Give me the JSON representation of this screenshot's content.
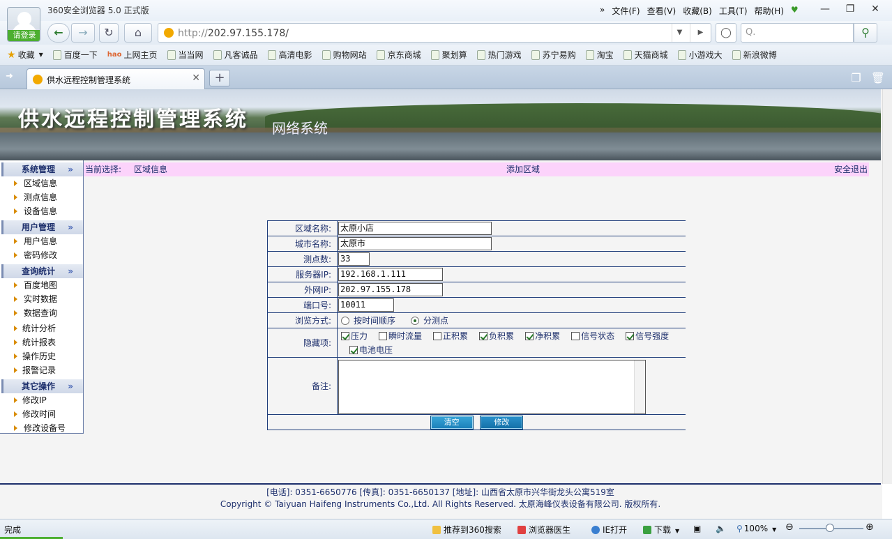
{
  "browser": {
    "app_title": "360安全浏览器 5.0 正式版",
    "login_label": "请登录",
    "menu": [
      "文件(F)",
      "查看(V)",
      "收藏(B)",
      "工具(T)",
      "帮助(H)"
    ],
    "menu_more": "»",
    "address_scheme": "http://",
    "address_host": "202.97.155.178/",
    "search_placeholder": "Q.",
    "bookmarks": [
      "收藏",
      "百度一下",
      "上网主页",
      "当当网",
      "凡客诚品",
      "高清电影",
      "购物网站",
      "京东商城",
      "聚划算",
      "热门游戏",
      "苏宁易购",
      "淘宝",
      "天猫商城",
      "小游戏大",
      "新浪微博"
    ],
    "tab_title": "供水远程控制管理系统",
    "new_tab": "+",
    "status_done": "完成",
    "status_items": {
      "recommend": "推荐到360搜索",
      "doctor": "浏览器医生",
      "ie_open": "IE打开",
      "download": "下载",
      "zoom": "100%"
    }
  },
  "banner": {
    "title": "供水远程控制管理系统",
    "subtitle": "网络系统"
  },
  "sidebar": {
    "sections": [
      {
        "title": "系统管理",
        "items": [
          "区域信息",
          "测点信息",
          "设备信息"
        ]
      },
      {
        "title": "用户管理",
        "items": [
          "用户信息",
          "密码修改"
        ]
      },
      {
        "title": "查询统计",
        "items": [
          "百度地图",
          "实时数据",
          "数据查询",
          "统计分析",
          "统计报表",
          "操作历史",
          "报警记录"
        ]
      },
      {
        "title": "其它操作",
        "items": [
          "修改IP",
          "修改时间",
          "修改设备号"
        ]
      }
    ]
  },
  "topline": {
    "current_label": "当前选择:",
    "current_value": "区域信息",
    "add_link": "添加区域",
    "logout": "安全退出"
  },
  "form": {
    "region_name_label": "区域名称:",
    "region_name": "太原小店",
    "city_label": "城市名称:",
    "city": "太原市",
    "points_label": "测点数:",
    "points": "33",
    "server_ip_label": "服务器IP:",
    "server_ip": "192.168.1.111",
    "public_ip_label": "外网IP:",
    "public_ip": "202.97.155.178",
    "port_label": "端口号:",
    "port": "10011",
    "browse_label": "浏览方式:",
    "browse_options": [
      {
        "label": "按时间顺序",
        "selected": false
      },
      {
        "label": "分测点",
        "selected": true
      }
    ],
    "hidden_label": "隐藏项:",
    "hidden_items": [
      {
        "label": "压力",
        "checked": true
      },
      {
        "label": "瞬时流量",
        "checked": false
      },
      {
        "label": "正积累",
        "checked": false
      },
      {
        "label": "负积累",
        "checked": true
      },
      {
        "label": "净积累",
        "checked": true
      },
      {
        "label": "信号状态",
        "checked": false
      },
      {
        "label": "信号强度",
        "checked": true
      },
      {
        "label": "电池电压",
        "checked": true
      }
    ],
    "remark_label": "备注:",
    "clear_button": "清空",
    "modify_button": "修改"
  },
  "footer": {
    "contact": "[电话]: 0351-6650776 [传真]: 0351-6650137 [地址]: 山西省太原市兴华街龙头公寓519室",
    "copyright": "Copyright © Taiyuan Haifeng Instruments Co.,Ltd. All Rights Reserved. 太原海峰仪表设备有限公司. 版权所有."
  }
}
